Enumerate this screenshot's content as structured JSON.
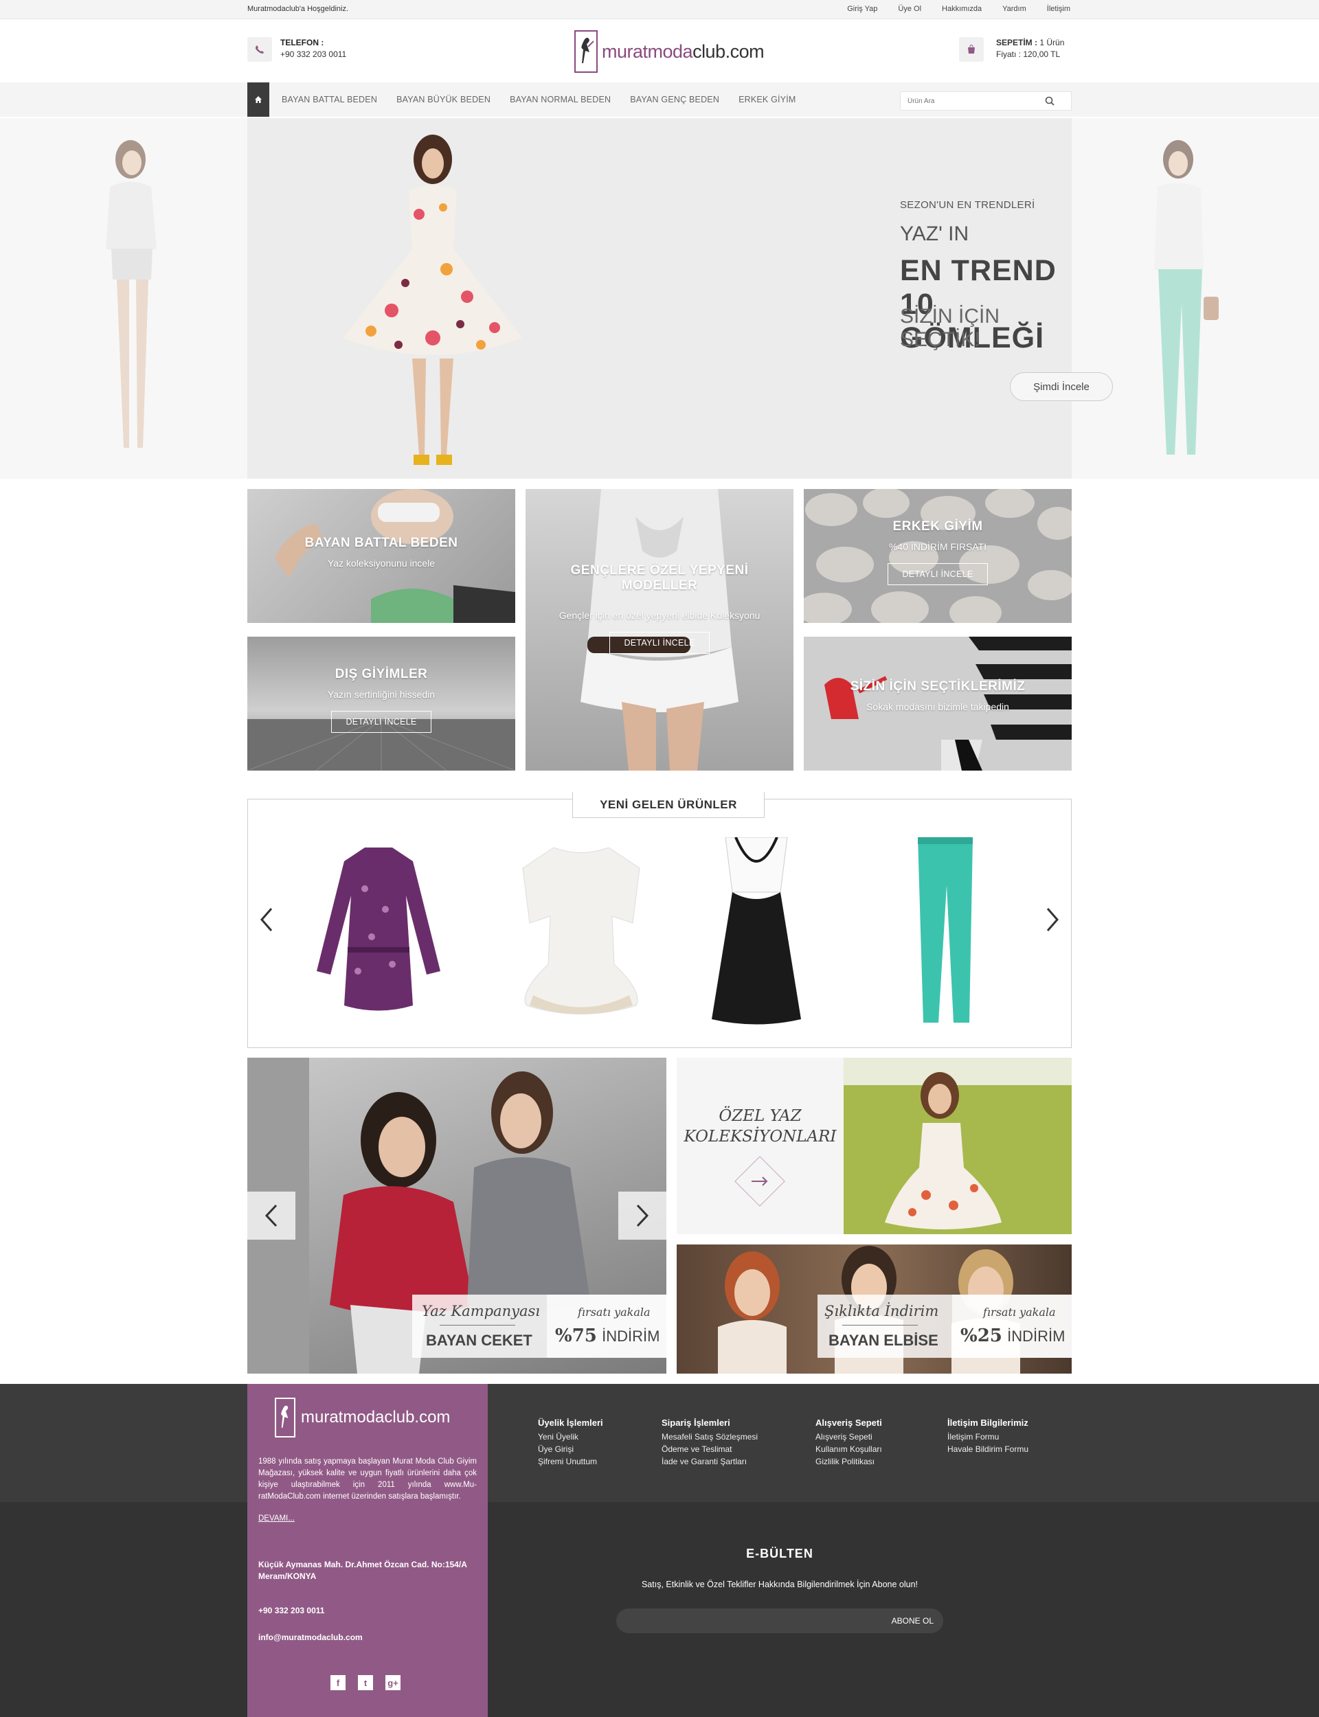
{
  "topbar": {
    "welcome": "Muratmodaclub'a Hoşgeldiniz.",
    "links": [
      "Giriş Yap",
      "Üye Ol",
      "Hakkımızda",
      "Yardım",
      "İletişim"
    ]
  },
  "header": {
    "phone_label": "TELEFON :",
    "phone_number": "+90 332 203 0011",
    "logo_text_a": "muratmoda",
    "logo_text_b": "club.com",
    "cart_label": "SEPETİM :",
    "cart_count": "1 Ürün",
    "cart_price": "Fiyatı : 120,00 TL"
  },
  "nav": {
    "items": [
      "BAYAN BATTAL BEDEN",
      "BAYAN BÜYÜK BEDEN",
      "BAYAN NORMAL BEDEN",
      "BAYAN GENÇ BEDEN",
      "ERKEK GİYİM"
    ],
    "search_placeholder": "Ürün Ara"
  },
  "hero": {
    "subtitle": "SEZON'UN EN TRENDLERİ",
    "line1": "YAZ' IN",
    "line2": "EN TREND 10 GÖMLEĞİ",
    "line3": "SİZİN İÇİN SEÇTİK!",
    "button": "Şimdi İncele"
  },
  "tiles": {
    "battal": {
      "title": "BAYAN BATTAL BEDEN",
      "sub": "Yaz koleksiyonunu incele"
    },
    "genc": {
      "title": "GENÇLERE ÖZEL YEPYENİ MODELLER",
      "sub": "Gençler için  en özel yepyeni elbide Koleksyonu",
      "button": "DETAYLI İNCELE"
    },
    "erkek": {
      "title": "ERKEK GİYİM",
      "sub": "%40 İNDİRİM FIRSATI",
      "button": "DETAYLI İNCELE"
    },
    "dis": {
      "title": "DIŞ GİYİMLER",
      "sub": "Yazın sertinliğini hissedin",
      "button": "DETAYLI İNCELE"
    },
    "secilen": {
      "title": "SİZİN İÇİN SEÇTİKLERİMİZ",
      "sub": "Sokak modasını bizimle takipedin"
    }
  },
  "new_products": {
    "title": "YENİ GELEN ÜRÜNLER",
    "items": [
      "purple-dress",
      "white-peplum-top",
      "black-white-dress",
      "turquoise-jeans"
    ]
  },
  "banners": {
    "jacket": {
      "script": "Yaz Kampanyası",
      "title": "BAYAN CEKET",
      "chance": "fırsatı yakala",
      "pct": "%75",
      "word": "İNDİRİM"
    },
    "summer": {
      "title": "ÖZEL YAZ KOLEKSİYONLARI"
    },
    "dress": {
      "script": "Şıklıkta İndirim",
      "title": "BAYAN ELBİSE",
      "chance": "fırsatı yakala",
      "pct": "%25",
      "word": "İNDİRİM"
    }
  },
  "footer": {
    "about": "1988 yılında satış yapmaya başlayan Murat Moda Club Giyim Mağazası, yüksek kalite ve uygun fiyatlı ürünlerini daha çok kişiye ulaştırabilmek için 2011 yılında www.Mu-ratModaClub.com internet üzerinden satışlara başlamıştır.",
    "more": "DEVAMI...",
    "address": "Küçük Aymanas Mah. Dr.Ahmet Özcan Cad. No:154/A Meram/KONYA",
    "phone": "+90 332 203 0011",
    "email": "info@muratmodaclub.com",
    "cols": [
      {
        "title": "Üyelik İşlemleri",
        "links": [
          "Yeni Üyelik",
          "Üye Girişi",
          "Şifremi Unuttum"
        ]
      },
      {
        "title": "Sipariş İşlemleri",
        "links": [
          "Mesafeli Satış Sözleşmesi",
          "Ödeme ve Teslimat",
          "İade ve Garanti Şartları"
        ]
      },
      {
        "title": "Alışveriş Sepeti",
        "links": [
          "Alışveriş Sepeti",
          "Kullanım Koşulları",
          "Gizlilik Politikası"
        ]
      },
      {
        "title": "İletişim Bilgilerimiz",
        "links": [
          "İletişim Formu",
          "Havale Bildirim Formu"
        ]
      }
    ],
    "bulletin_title": "E-BÜLTEN",
    "bulletin_text": "Satış, Etkinlik ve Özel Teklifler Hakkında Bilgilendirilmek İçin Abone olun!",
    "bulletin_button": "ABONE OL"
  },
  "colors": {
    "brand": "#915a86",
    "dark": "#333333"
  }
}
